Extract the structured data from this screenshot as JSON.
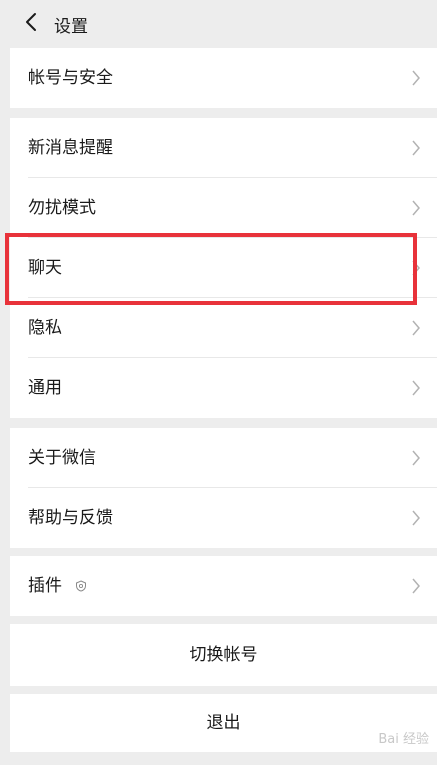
{
  "header": {
    "title": "设置"
  },
  "groups": [
    {
      "items": [
        {
          "label": "帐号与安全"
        }
      ]
    },
    {
      "items": [
        {
          "label": "新消息提醒"
        },
        {
          "label": "勿扰模式"
        },
        {
          "label": "聊天"
        },
        {
          "label": "隐私"
        },
        {
          "label": "通用"
        }
      ]
    },
    {
      "items": [
        {
          "label": "关于微信"
        },
        {
          "label": "帮助与反馈"
        }
      ]
    },
    {
      "items": [
        {
          "label": "插件"
        }
      ]
    }
  ],
  "actions": {
    "switch_account": "切换帐号",
    "logout": "退出"
  },
  "highlight": {
    "target": "聊天",
    "color": "#e8323a"
  },
  "watermark": {
    "text": "Bai 经验"
  },
  "icons": {
    "back": "chevron-left-icon",
    "row": "chevron-right-icon",
    "plugin": "plugin-badge-icon"
  }
}
